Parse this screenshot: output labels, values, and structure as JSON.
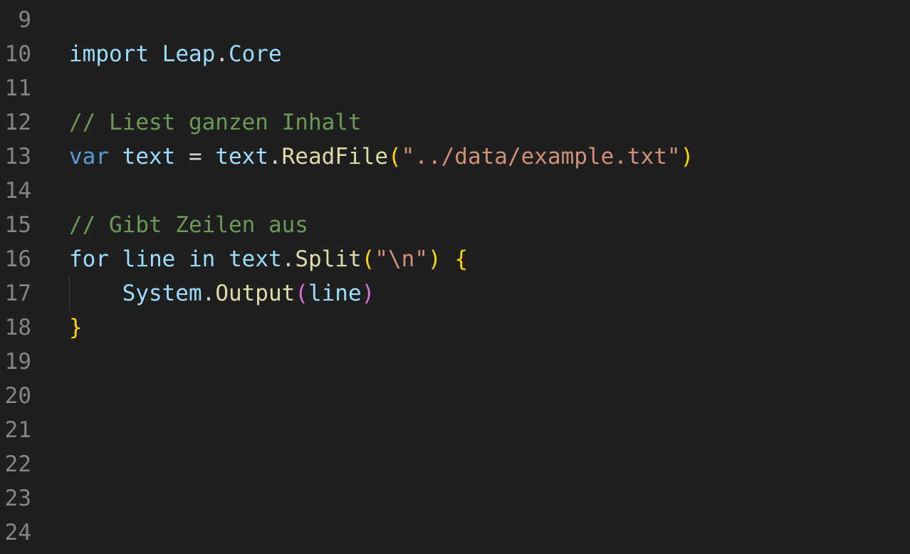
{
  "editor": {
    "line_numbers": [
      "9",
      "10",
      "11",
      "12",
      "13",
      "14",
      "15",
      "16",
      "17",
      "18",
      "19",
      "20",
      "21",
      "22",
      "23",
      "24"
    ],
    "colors": {
      "background": "#1f1f1f",
      "line_number": "#858585",
      "keyword": "#569cd6",
      "identifier": "#9cdcfe",
      "function": "#dcdcaa",
      "string": "#ce9178",
      "comment": "#6a9955",
      "bracket_level1": "#ffd700",
      "bracket_level2": "#da70d6"
    },
    "code": {
      "l10": {
        "kw": "import",
        "mod1": "Leap",
        "dot": ".",
        "mod2": "Core"
      },
      "l12": {
        "comment": "// Liest ganzen Inhalt"
      },
      "l13": {
        "kw": "var",
        "var": "text",
        "eq": "=",
        "obj": "text",
        "dot": ".",
        "fn": "ReadFile",
        "open": "(",
        "str": "\"../data/example.txt\"",
        "close": ")"
      },
      "l15": {
        "comment": "// Gibt Zeilen aus"
      },
      "l16": {
        "kw": "for",
        "var": "line",
        "in": "in",
        "obj": "text",
        "dot": ".",
        "fn": "Split",
        "open": "(",
        "str_q1": "\"",
        "esc": "\\n",
        "str_q2": "\"",
        "close": ")",
        "brace": "{"
      },
      "l17": {
        "obj": "System",
        "dot": ".",
        "fn": "Output",
        "open": "(",
        "arg": "line",
        "close": ")"
      },
      "l18": {
        "brace": "}"
      }
    }
  }
}
